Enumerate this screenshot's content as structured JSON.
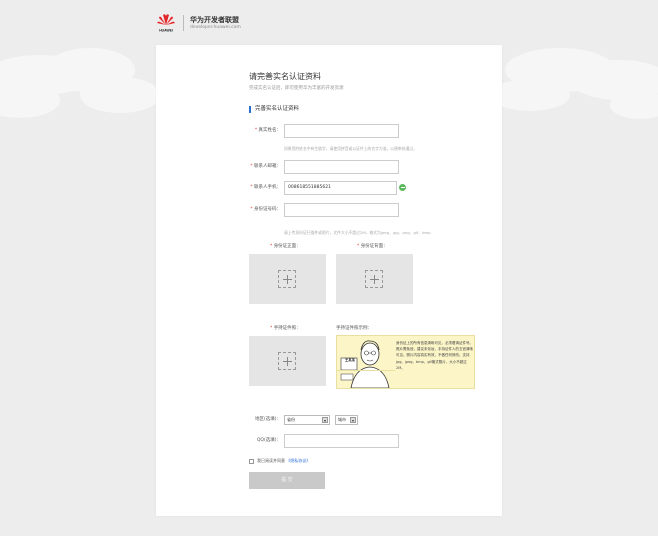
{
  "header": {
    "brand_title": "华为开发者联盟",
    "brand_sub": "developer.huawei.com",
    "logo_text": "HUAWEI"
  },
  "page": {
    "title": "请完善实名认证资料",
    "subtitle": "完成实名认证后，即可使用华为丰富的开发资源",
    "section_title": "完善实名认证资料"
  },
  "form": {
    "name_label": "真实姓名：",
    "name_hint": "如果您的姓名中有生僻字，请使用拼音或以证件上的名字为准，以便审核通过。",
    "email_label": "联系人邮箱：",
    "phone_label": "联系人手机：",
    "phone_value": "008618551885621",
    "id_label": "身份证号码：",
    "photo_hint": "请上传身份证扫描件或照片，文件大小不超过2M，格式为jpeg、jpg、png、gif、bmp",
    "id_front_label": "身份证正面：",
    "id_back_label": "身份证背面：",
    "handheld_label": "手持证件照：",
    "example_label": "手持证件照示例：",
    "example_text": "身份证上的所有信息清晰可见，必须看清证件号。照片需免冠，建议未化妆，手持证件人的五官清晰可见。照片内容真实有效，不做任何修改。支持jpg、jpeg、bmp、gif格式照片，大小不超过2M。",
    "example_card_name": "王某某",
    "region_label": "地区(选填)：",
    "province_value": "省份",
    "city_value": "城市",
    "qq_label": "QQ(选填)：",
    "required_mark": "*",
    "agree_text": "我已阅读并同意",
    "agree_link": "《隐私协议》",
    "submit_label": "提 交"
  },
  "colors": {
    "accent": "#2a6fd6",
    "required": "#e33333",
    "background": "#ededed",
    "example_bg": "#fbf5c8",
    "submit_disabled": "#c9c9c9"
  },
  "icons": {
    "logo": "huawei-petal-icon",
    "verify": "check-circle-icon",
    "upload": "plus-icon",
    "dropdown": "caret-down-icon"
  }
}
